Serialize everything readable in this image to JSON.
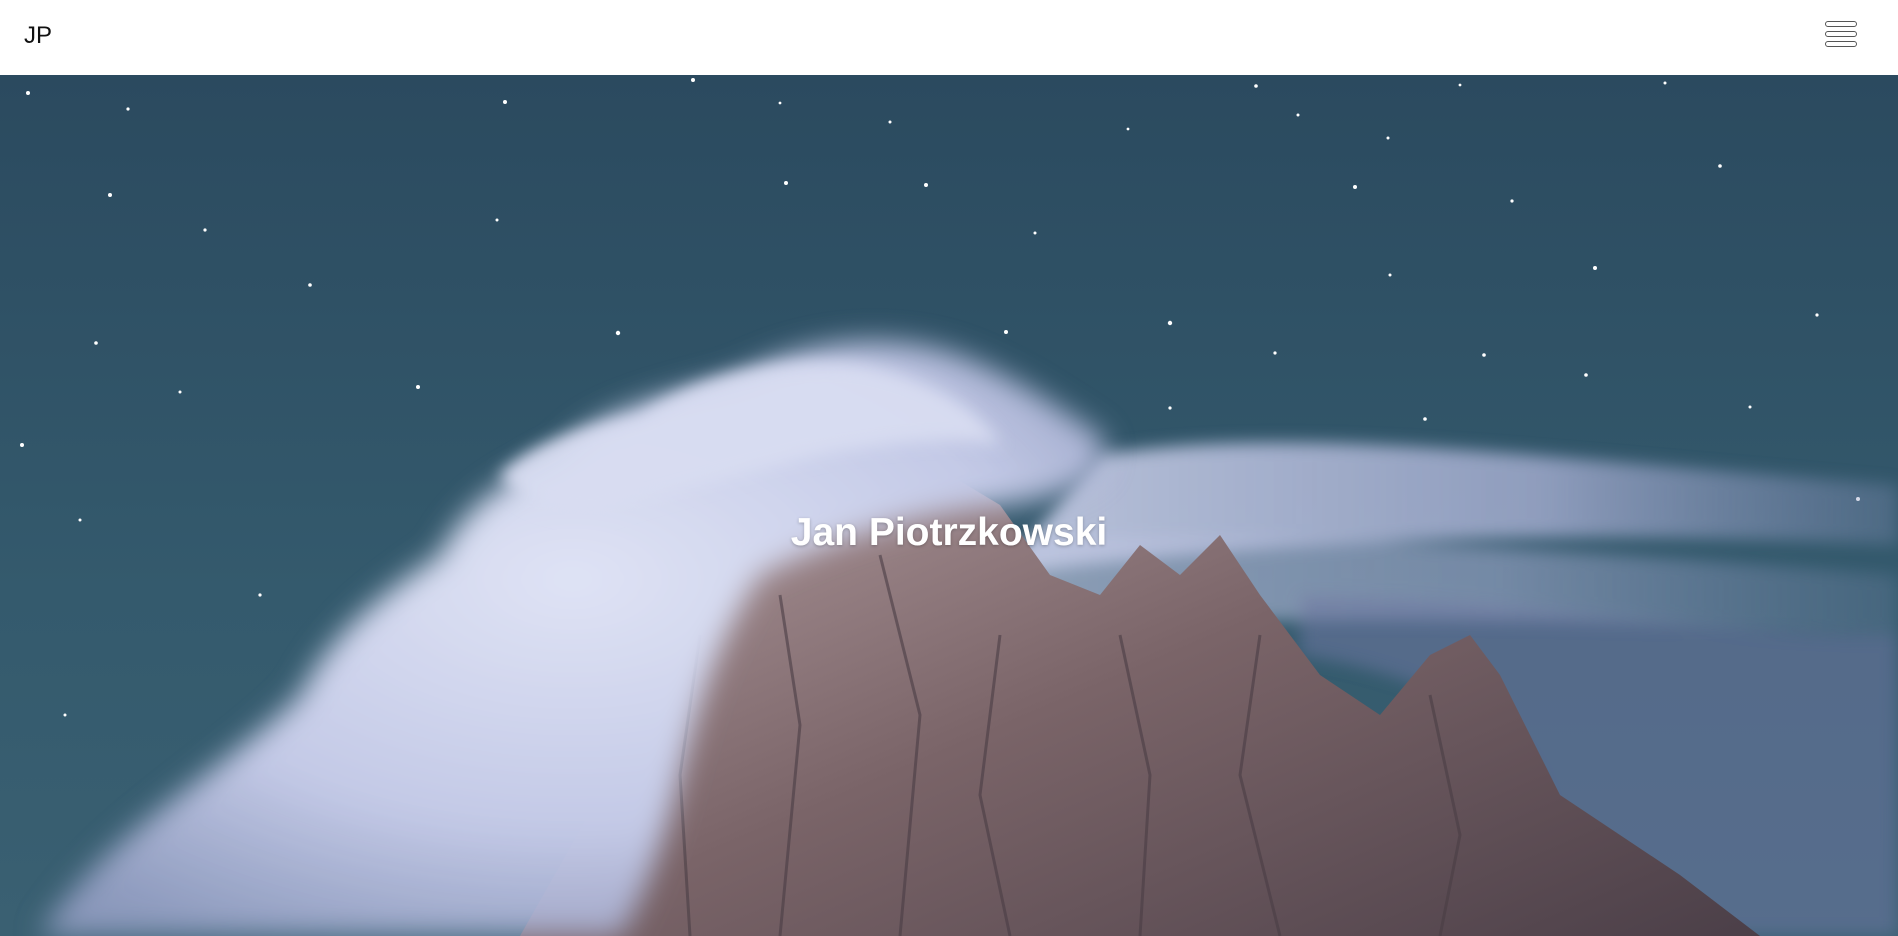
{
  "header": {
    "logo": "JP",
    "menu_icon": "hamburger-icon"
  },
  "hero": {
    "title": "Jan Piotrzkowski",
    "image_description_icon": "mountain-night-sky-image",
    "colors": {
      "sky_top": "#2c4a5e",
      "sky_bottom": "#355a6c",
      "cloud": "#c9d0ea",
      "rock": "#7a6468"
    }
  }
}
